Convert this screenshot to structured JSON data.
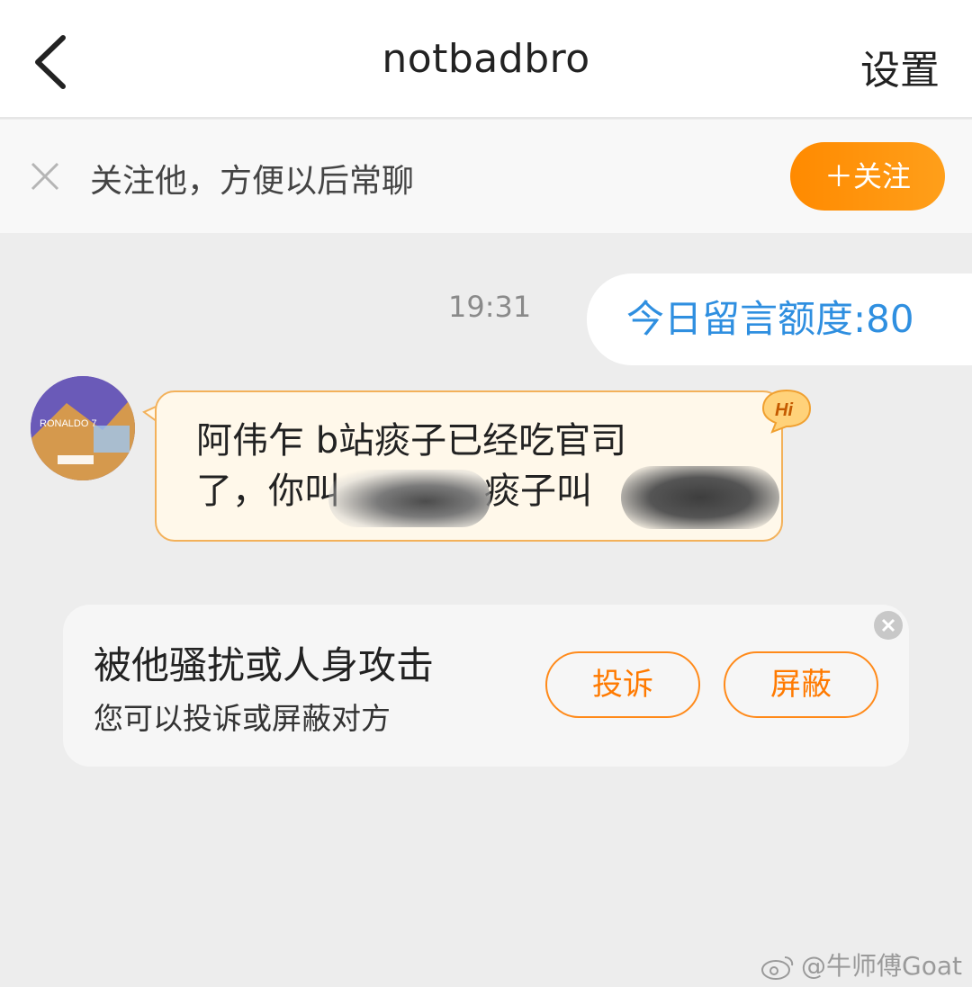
{
  "header": {
    "title": "notbadbro",
    "settings_label": "设置"
  },
  "follow_bar": {
    "prompt": "关注他，方便以后常聊",
    "follow_button": "＋关注"
  },
  "chat": {
    "timestamp": "19:31",
    "quota_message": "今日留言额度:80",
    "incoming_message": {
      "line1": "阿伟乍 b站痰子已经吃官司",
      "line2_prefix": "了，你叫",
      "line2_mid": "痰子叫",
      "badge": "Hi"
    },
    "avatar_text": "RONALDO 7"
  },
  "report_card": {
    "title": "被他骚扰或人身攻击",
    "subtitle": "您可以投诉或屏蔽对方",
    "complain_button": "投诉",
    "block_button": "屏蔽"
  },
  "watermark": "@牛师傅Goat",
  "colors": {
    "accent_orange": "#ff8a00",
    "link_blue": "#2f8fe0"
  }
}
